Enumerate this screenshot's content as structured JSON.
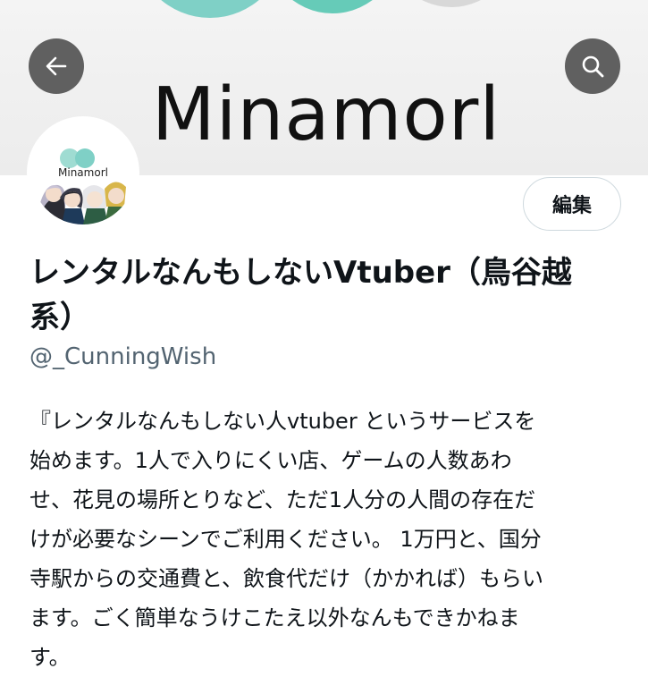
{
  "header": {
    "back_icon": "arrow-left-icon",
    "search_icon": "search-icon",
    "banner_logo_text": "Minamorl",
    "banner_colors": [
      "#7fd0c6",
      "#66cbb8",
      "#d8d8d8"
    ]
  },
  "avatar": {
    "logo_text": "Minamorl"
  },
  "profile": {
    "edit_label": "編集",
    "display_name": "レンタルなんもしないVtuber（鳥谷越 系）",
    "handle": "@_CunningWish",
    "bio": "『レンタルなんもしない人vtuber というサービスを\n始めます。1人で入りにくい店、ゲームの人数あわ\nせ、花見の場所とりなど、ただ1人分の人間の存在だ\nけが必要なシーンでご利用ください。 1万円と、国分\n寺駅からの交通費と、飲食代だけ（かかれば）もらい\nます。ごく簡単なうけこたえ以外なんもできかねま\nす。"
  },
  "colors": {
    "text": "#0f1419",
    "secondary_text": "#536471",
    "button_border": "#cfd9de"
  }
}
